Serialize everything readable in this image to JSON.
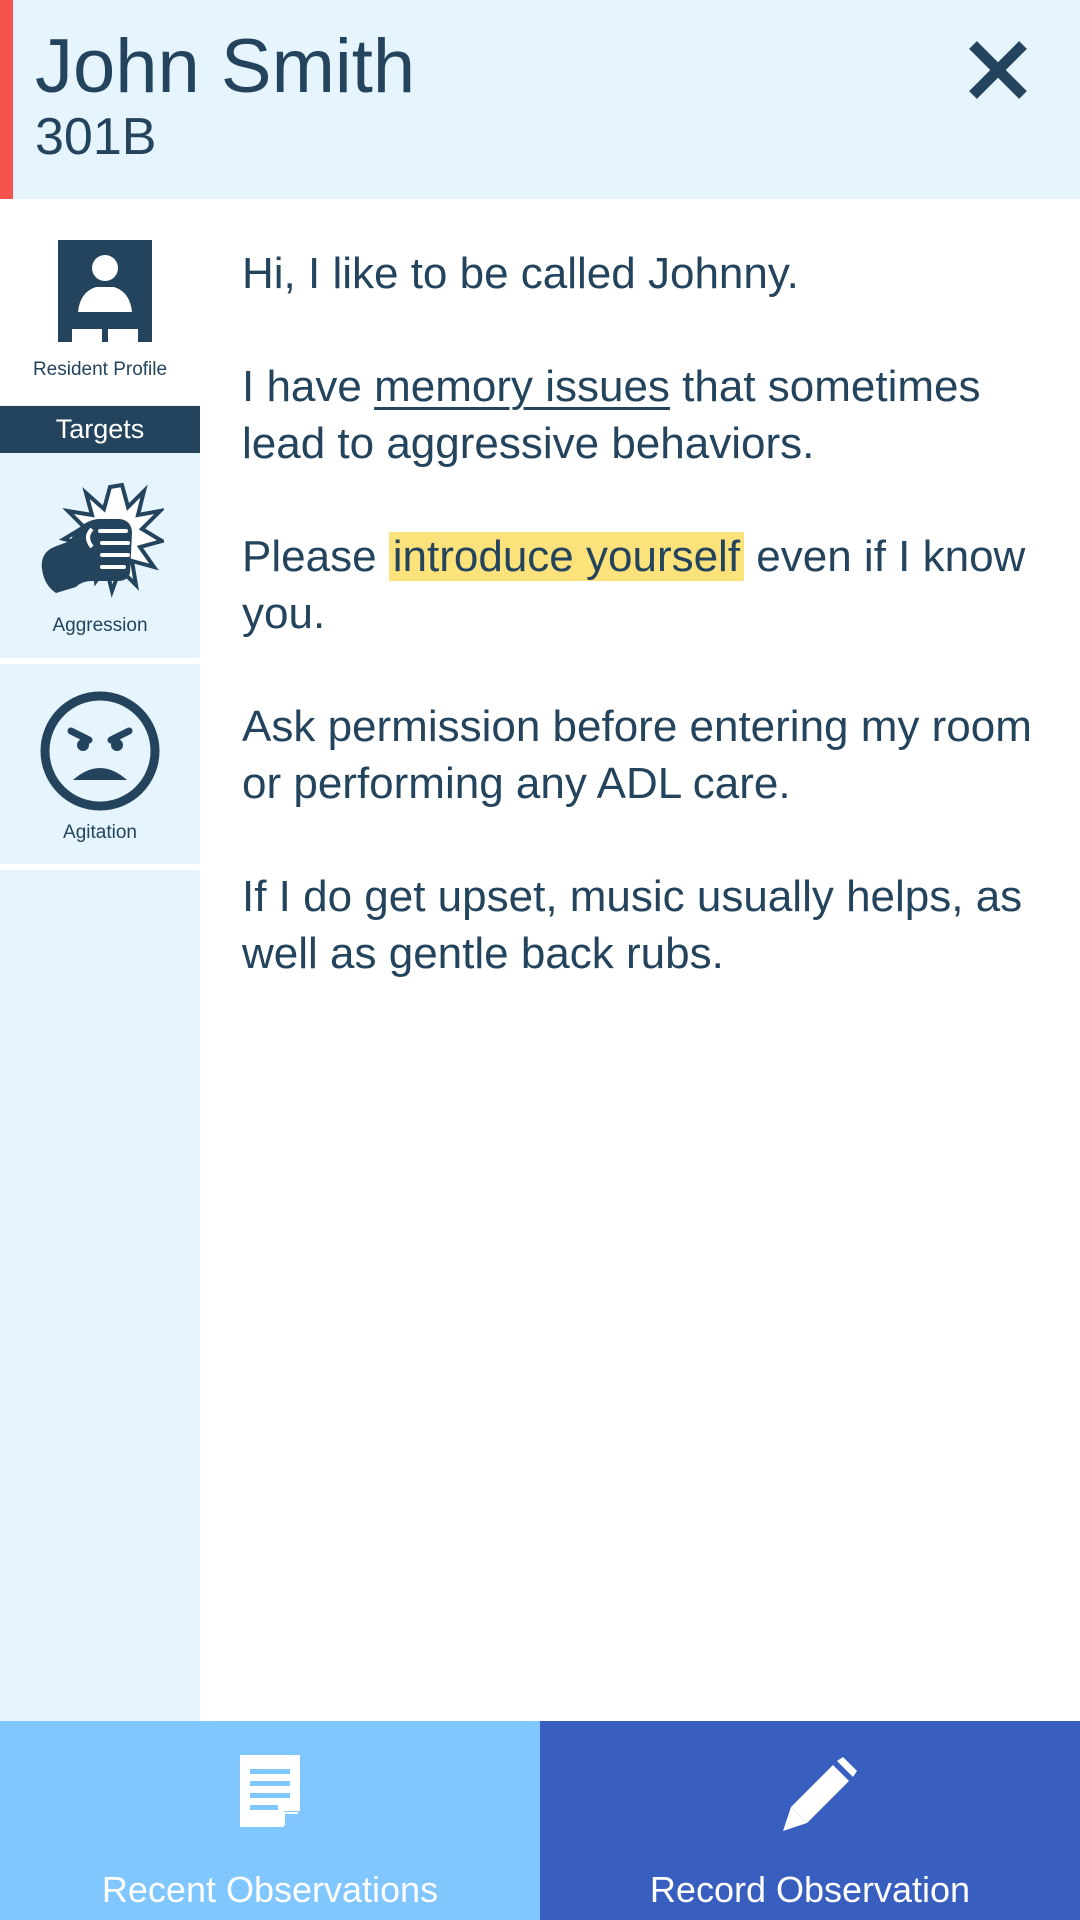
{
  "header": {
    "resident_name": "John Smith",
    "room": "301B",
    "close_icon": "close-icon",
    "accent_color": "#f4534e",
    "background_color": "#e6f4fd"
  },
  "sidebar": {
    "profile": {
      "label": "Resident Profile",
      "icon": "resident-profile-icon"
    },
    "targets_title": "Targets",
    "targets": [
      {
        "label": "Aggression",
        "icon": "fist-aggression-icon"
      },
      {
        "label": "Agitation",
        "icon": "angry-face-icon"
      }
    ]
  },
  "content": {
    "paragraphs": [
      {
        "text": "Hi, I like to be called Johnny."
      },
      {
        "before": "I have ",
        "underlined": "memory issues",
        "after": " that sometimes lead to aggressive behaviors."
      },
      {
        "before": "Please ",
        "highlighted": "introduce yourself",
        "after": " even if I know you."
      },
      {
        "text": "Ask permission before entering my room or performing any ADL care."
      },
      {
        "text": "If I do get upset, music usually helps, as well as gentle back rubs."
      }
    ],
    "highlight_color": "#fbe27a"
  },
  "footer": {
    "recent": {
      "label": "Recent Observations",
      "icon": "document-icon",
      "color": "#80c6ff"
    },
    "record": {
      "label": "Record Observation",
      "icon": "pencil-icon",
      "color": "#385ebf"
    }
  }
}
